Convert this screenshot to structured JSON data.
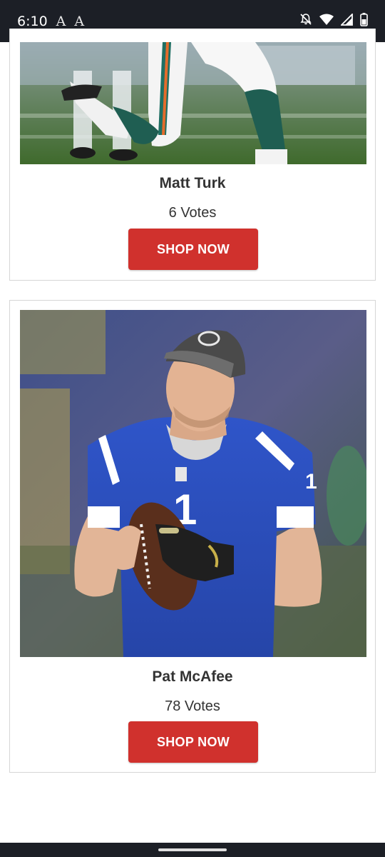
{
  "status_bar": {
    "time": "6:10",
    "indicator_1": "A",
    "indicator_2": "A",
    "icons": [
      "notifications-off-icon",
      "wifi-icon",
      "signal-icon",
      "battery-icon"
    ]
  },
  "players": [
    {
      "name": "Matt Turk",
      "votes": "6 Votes",
      "button_label": "SHOP NOW"
    },
    {
      "name": "Pat McAfee",
      "votes": "78 Votes",
      "button_label": "SHOP NOW"
    }
  ],
  "colors": {
    "button": "#d0312d",
    "status_bar": "#1c1f26",
    "text": "#333333"
  }
}
